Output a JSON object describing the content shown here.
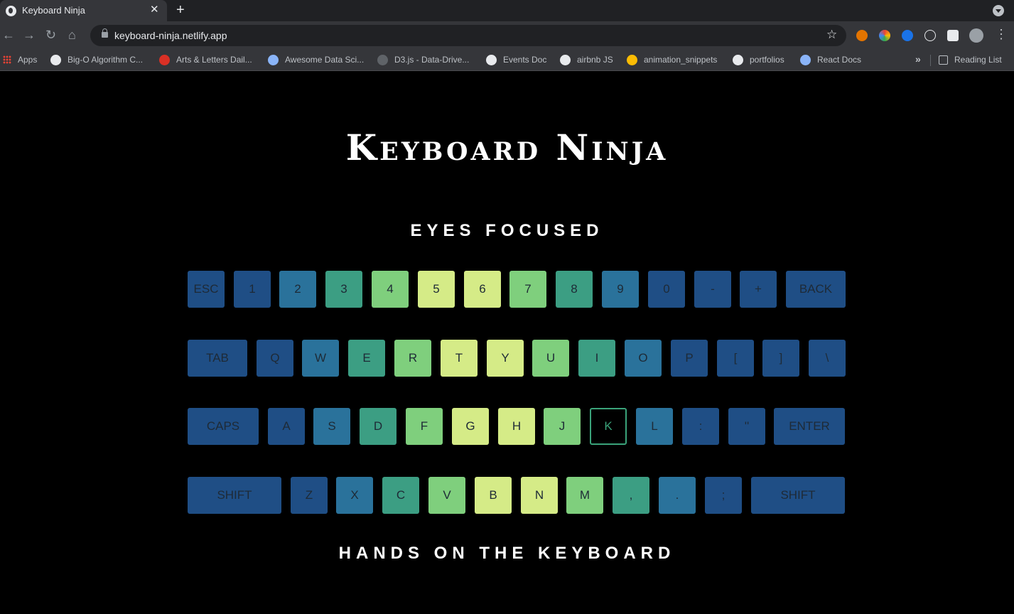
{
  "browser": {
    "tab_title": "Keyboard Ninja",
    "url": "keyboard-ninja.netlify.app",
    "bookmarks": [
      {
        "label": "Apps",
        "icon": "apps-grid-icon",
        "color": "#ea4335"
      },
      {
        "label": "Big-O Algorithm C...",
        "icon": "globe-icon",
        "color": "#e8eaed"
      },
      {
        "label": "Arts & Letters Dail...",
        "icon": "arts-letters-icon",
        "color": "#d93025"
      },
      {
        "label": "Awesome Data Sci...",
        "icon": "react-icon",
        "color": "#8ab4f8"
      },
      {
        "label": "D3.js - Data-Drive...",
        "icon": "d3-icon",
        "color": "#5f6368"
      },
      {
        "label": "Events Doc",
        "icon": "cat-icon",
        "color": "#e8eaed"
      },
      {
        "label": "airbnb JS",
        "icon": "github-icon",
        "color": "#e8eaed"
      },
      {
        "label": "animation_snippets",
        "icon": "snippet-icon",
        "color": "#fbbc04"
      },
      {
        "label": "portfolios",
        "icon": "github-icon",
        "color": "#e8eaed"
      },
      {
        "label": "React Docs",
        "icon": "react-icon",
        "color": "#8ab4f8"
      }
    ],
    "reading_list": "Reading List",
    "more_bookmarks": "»"
  },
  "page": {
    "title": "Keyboard Ninja",
    "subtitle_top": "EYES FOCUSED",
    "subtitle_bottom": "HANDS ON THE KEYBOARD"
  },
  "palette": {
    "navy": "#1f4e85",
    "blue": "#2a729b",
    "teal": "#3c9e83",
    "green": "#7fcf7d",
    "lime": "#d5eb87",
    "focus_border": "#3aa37a"
  },
  "keyboard": {
    "rows": [
      [
        {
          "label": "ESC",
          "tone": "navy"
        },
        {
          "label": "1",
          "tone": "navy"
        },
        {
          "label": "2",
          "tone": "blue"
        },
        {
          "label": "3",
          "tone": "teal"
        },
        {
          "label": "4",
          "tone": "green"
        },
        {
          "label": "5",
          "tone": "lime"
        },
        {
          "label": "6",
          "tone": "lime"
        },
        {
          "label": "7",
          "tone": "green"
        },
        {
          "label": "8",
          "tone": "teal"
        },
        {
          "label": "9",
          "tone": "blue"
        },
        {
          "label": "0",
          "tone": "navy"
        },
        {
          "label": "-",
          "tone": "navy"
        },
        {
          "label": "+",
          "tone": "navy"
        },
        {
          "label": "BACK",
          "tone": "navy"
        }
      ],
      [
        {
          "label": "TAB",
          "tone": "navy"
        },
        {
          "label": "Q",
          "tone": "navy"
        },
        {
          "label": "W",
          "tone": "blue"
        },
        {
          "label": "E",
          "tone": "teal"
        },
        {
          "label": "R",
          "tone": "green"
        },
        {
          "label": "T",
          "tone": "lime"
        },
        {
          "label": "Y",
          "tone": "lime"
        },
        {
          "label": "U",
          "tone": "green"
        },
        {
          "label": "I",
          "tone": "teal"
        },
        {
          "label": "O",
          "tone": "blue"
        },
        {
          "label": "P",
          "tone": "navy"
        },
        {
          "label": "[",
          "tone": "navy"
        },
        {
          "label": "]",
          "tone": "navy"
        },
        {
          "label": "\\",
          "tone": "navy"
        }
      ],
      [
        {
          "label": "CAPS",
          "tone": "navy"
        },
        {
          "label": "A",
          "tone": "navy"
        },
        {
          "label": "S",
          "tone": "blue"
        },
        {
          "label": "D",
          "tone": "teal"
        },
        {
          "label": "F",
          "tone": "green"
        },
        {
          "label": "G",
          "tone": "lime"
        },
        {
          "label": "H",
          "tone": "lime"
        },
        {
          "label": "J",
          "tone": "green"
        },
        {
          "label": "K",
          "tone": "teal",
          "focused": true
        },
        {
          "label": "L",
          "tone": "blue"
        },
        {
          "label": ":",
          "tone": "navy"
        },
        {
          "label": "''",
          "tone": "navy"
        },
        {
          "label": "ENTER",
          "tone": "navy"
        }
      ],
      [
        {
          "label": "SHIFT",
          "tone": "navy"
        },
        {
          "label": "Z",
          "tone": "navy"
        },
        {
          "label": "X",
          "tone": "blue"
        },
        {
          "label": "C",
          "tone": "teal"
        },
        {
          "label": "V",
          "tone": "green"
        },
        {
          "label": "B",
          "tone": "lime"
        },
        {
          "label": "N",
          "tone": "lime"
        },
        {
          "label": "M",
          "tone": "green"
        },
        {
          "label": ",",
          "tone": "teal"
        },
        {
          "label": ".",
          "tone": "blue"
        },
        {
          "label": ";",
          "tone": "navy"
        },
        {
          "label": "SHIFT",
          "tone": "navy"
        }
      ]
    ]
  }
}
